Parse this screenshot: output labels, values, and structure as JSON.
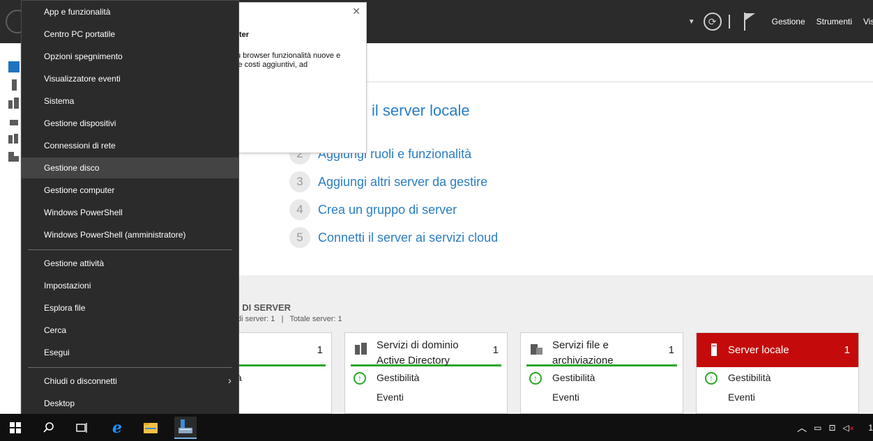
{
  "header": {
    "menu": [
      "Gestione",
      "Strumenti",
      "Visualizza"
    ]
  },
  "welcome": {
    "title": "il server locale",
    "steps": [
      {
        "num": "2",
        "text": "Aggiungi ruoli e funzionalità"
      },
      {
        "num": "3",
        "text": "Aggiungi altri server da gestire"
      },
      {
        "num": "4",
        "text": "Crea un gruppo di server"
      },
      {
        "num": "5",
        "text": "Connetti il server ai servizi cloud"
      }
    ]
  },
  "groups": {
    "title": "I DI SERVER",
    "subtitle_left": "di server: 1",
    "subtitle_right": "Totale server: 1",
    "tiles": [
      {
        "title": "",
        "count": "1",
        "row1": "à"
      },
      {
        "title_line1": "Servizi di dominio",
        "title_line2": "Active Directory",
        "count": "1",
        "row1": "Gestibilità",
        "row2": "Eventi"
      },
      {
        "title_line1": "Servizi file e",
        "title_line2": "archiviazione",
        "count": "1",
        "row1": "Gestibilità",
        "row2": "Eventi"
      },
      {
        "title": "Server locale",
        "count": "1",
        "row1": "Gestibilità",
        "row2": "Eventi"
      }
    ]
  },
  "toast": {
    "title": "ter",
    "body": "u browser funzionalità nuove e le costi aggiuntivi, ad"
  },
  "winx_menu": {
    "items": [
      "App e funzionalità",
      "Centro PC portatile",
      "Opzioni spegnimento",
      "Visualizzatore eventi",
      "Sistema",
      "Gestione dispositivi",
      "Connessioni di rete",
      "Gestione disco",
      "Gestione computer",
      "Windows PowerShell",
      "Windows PowerShell (amministratore)",
      "Gestione attività",
      "Impostazioni",
      "Esplora file",
      "Cerca",
      "Esegui",
      "Chiudi o disconnetti",
      "Desktop"
    ],
    "highlighted": "Gestione disco"
  },
  "tray": {
    "time_fragment": "1"
  },
  "colors": {
    "accent_blue": "#2a7ec4",
    "ok_green": "#29a829",
    "alert_red": "#c40a0a",
    "menu_bg": "#2b2b2b"
  }
}
